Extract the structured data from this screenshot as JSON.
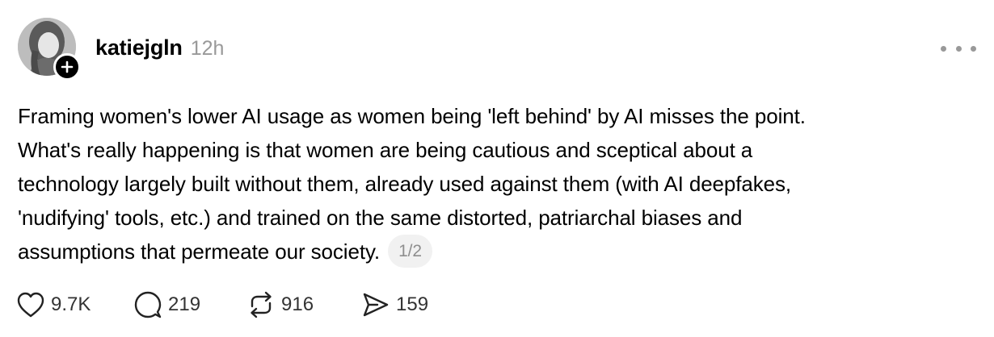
{
  "post": {
    "author": {
      "username": "katiejgln",
      "timestamp": "12h"
    },
    "body_lines": [
      "Framing women's lower AI usage as women being 'left behind' by AI misses the point.",
      "What's really happening is that women are being cautious and sceptical about a",
      "technology largely built without them, already used against them (with AI deepfakes,",
      "'nudifying' tools, etc.) and trained on the same distorted, patriarchal biases and",
      "assumptions that permeate our society."
    ],
    "page_indicator": "1/2",
    "stats": {
      "likes": "9.7K",
      "replies": "219",
      "reposts": "916",
      "shares": "159"
    }
  },
  "icons": {
    "follow": "plus-icon",
    "more": "more-horizontal-icon",
    "like": "heart-icon",
    "reply": "comment-bubble-icon",
    "repost": "repost-icon",
    "share": "send-icon"
  },
  "colors": {
    "text": "#000000",
    "muted": "#999999",
    "pill_bg": "#f1f1f1"
  }
}
